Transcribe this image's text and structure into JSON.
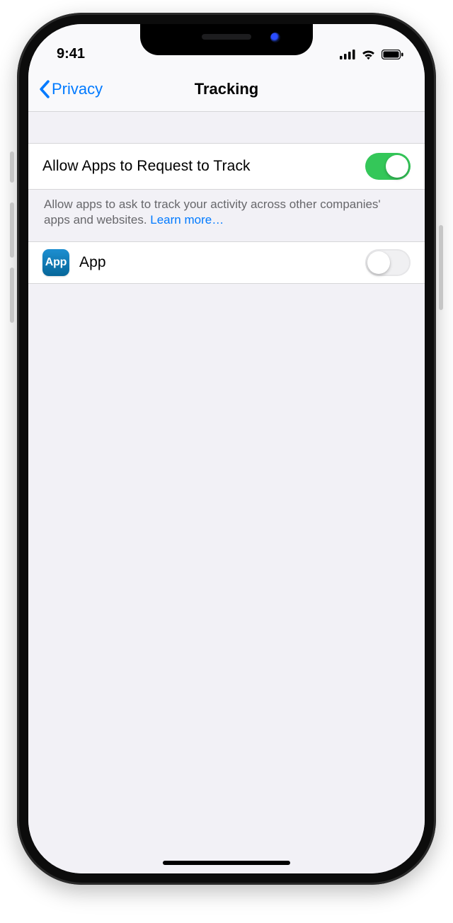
{
  "status": {
    "time": "9:41"
  },
  "nav": {
    "back_label": "Privacy",
    "title": "Tracking"
  },
  "main_toggle": {
    "label": "Allow Apps to Request to Track",
    "on": true
  },
  "footer": {
    "text": "Allow apps to ask to track your activity across other companies' apps and websites. ",
    "learn_more": "Learn more…"
  },
  "apps": [
    {
      "name": "App",
      "icon_text": "App",
      "tracking_on": false
    }
  ]
}
